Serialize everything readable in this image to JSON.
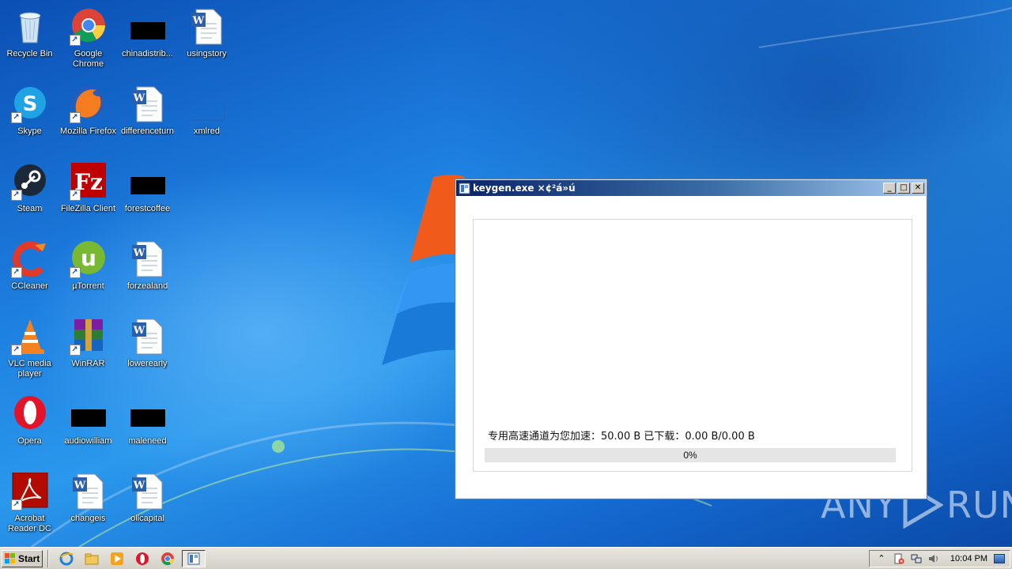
{
  "desktop": {
    "icons": [
      {
        "label": "Recycle Bin",
        "icon": "recycle-bin-icon"
      },
      {
        "label": "Google Chrome",
        "icon": "chrome-icon"
      },
      {
        "label": "chinadistrib...",
        "icon": "blank-file-icon"
      },
      {
        "label": "usingstory",
        "icon": "word-doc-icon"
      },
      {
        "label": "Skype",
        "icon": "skype-icon"
      },
      {
        "label": "Mozilla Firefox",
        "icon": "firefox-icon"
      },
      {
        "label": "differenceturn",
        "icon": "word-doc-icon"
      },
      {
        "label": "xmlred",
        "icon": "blank-file-icon"
      },
      {
        "label": "Steam",
        "icon": "steam-icon"
      },
      {
        "label": "FileZilla Client",
        "icon": "filezilla-icon"
      },
      {
        "label": "forestcoffee",
        "icon": "blank-file-icon"
      },
      {
        "label": "CCleaner",
        "icon": "ccleaner-icon"
      },
      {
        "label": "µTorrent",
        "icon": "utorrent-icon"
      },
      {
        "label": "forzealand",
        "icon": "word-doc-icon"
      },
      {
        "label": "VLC media player",
        "icon": "vlc-icon"
      },
      {
        "label": "WinRAR",
        "icon": "winrar-icon"
      },
      {
        "label": "lowerearly",
        "icon": "word-doc-icon"
      },
      {
        "label": "Opera",
        "icon": "opera-icon"
      },
      {
        "label": "audiowilliam",
        "icon": "blank-file-icon"
      },
      {
        "label": "maleneed",
        "icon": "blank-file-icon"
      },
      {
        "label": "Acrobat Reader DC",
        "icon": "acrobat-icon"
      },
      {
        "label": "changeis",
        "icon": "word-doc-icon"
      },
      {
        "label": "ollcapital",
        "icon": "word-doc-icon"
      }
    ]
  },
  "dialog": {
    "title": "keygen.exe ×¢²á»ú",
    "minimize": "_",
    "maximize": "□",
    "close": "✕",
    "speed_text": "专用高速通道为您加速：50.00 B    已下载：0.00 B/0.00 B",
    "progress_label": "0%",
    "progress_value": 0
  },
  "watermark": {
    "left": "ANY",
    "right": "RUN"
  },
  "taskbar": {
    "start_label": "Start",
    "quick_launch": [
      "ie-icon",
      "explorer-icon",
      "media-player-icon",
      "opera-icon",
      "chrome-icon"
    ],
    "active_task": "keygen-task-icon",
    "tray_icons": [
      "show-hidden-icon",
      "action-center-icon",
      "network-icon",
      "volume-icon"
    ],
    "clock": "10:04 PM"
  },
  "colors": {
    "titlebar_start": "#0a246a",
    "titlebar_end": "#a6caf0",
    "progress_track": "#e5e5e5"
  }
}
